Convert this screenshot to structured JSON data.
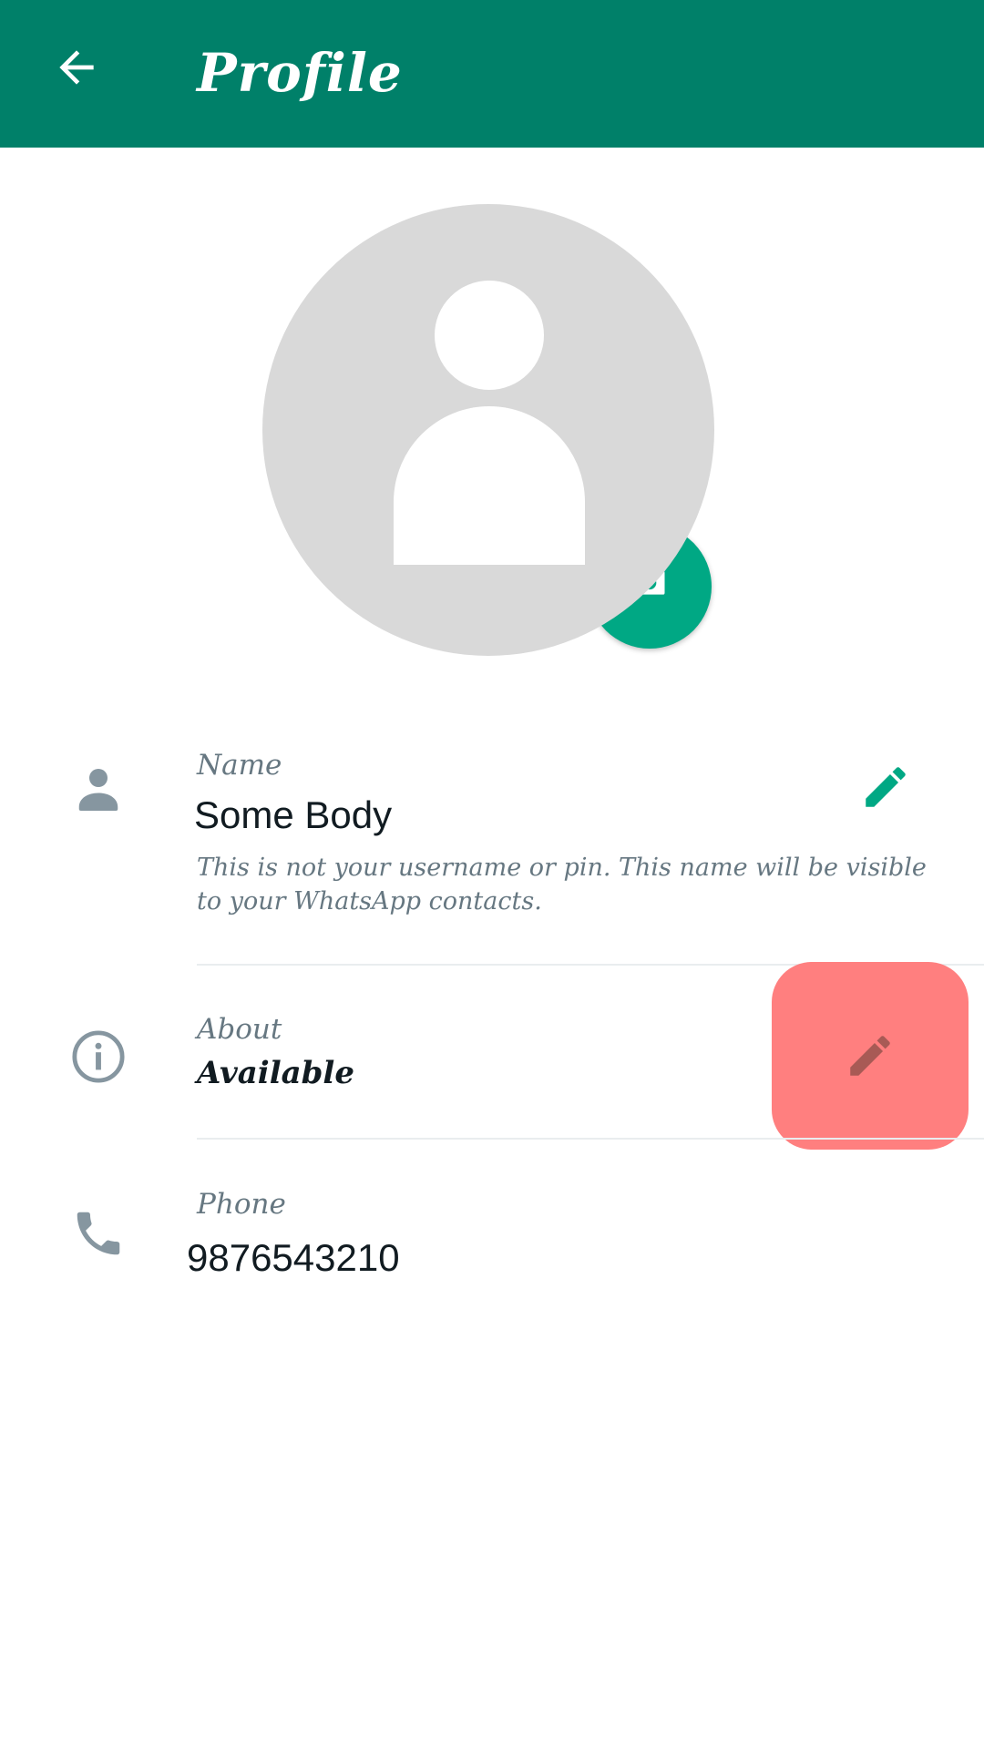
{
  "app_bar": {
    "title": "Profile",
    "color": "#008069",
    "back_icon": "arrow-back-icon"
  },
  "avatar": {
    "icon": "default-person-icon",
    "camera_icon": "camera-icon"
  },
  "name_row": {
    "icon": "person-icon",
    "label": "Name",
    "value": "Some Body",
    "hint": "This is not your username or pin. This name will be visible to your WhatsApp contacts.",
    "edit_icon": "pencil-icon"
  },
  "about_row": {
    "icon": "info-icon",
    "label": "About",
    "value": "Available",
    "edit_icon": "pencil-icon",
    "highlight_color": "#ff7f7f"
  },
  "phone_row": {
    "icon": "phone-icon",
    "label": "Phone",
    "value": "9876543210"
  }
}
